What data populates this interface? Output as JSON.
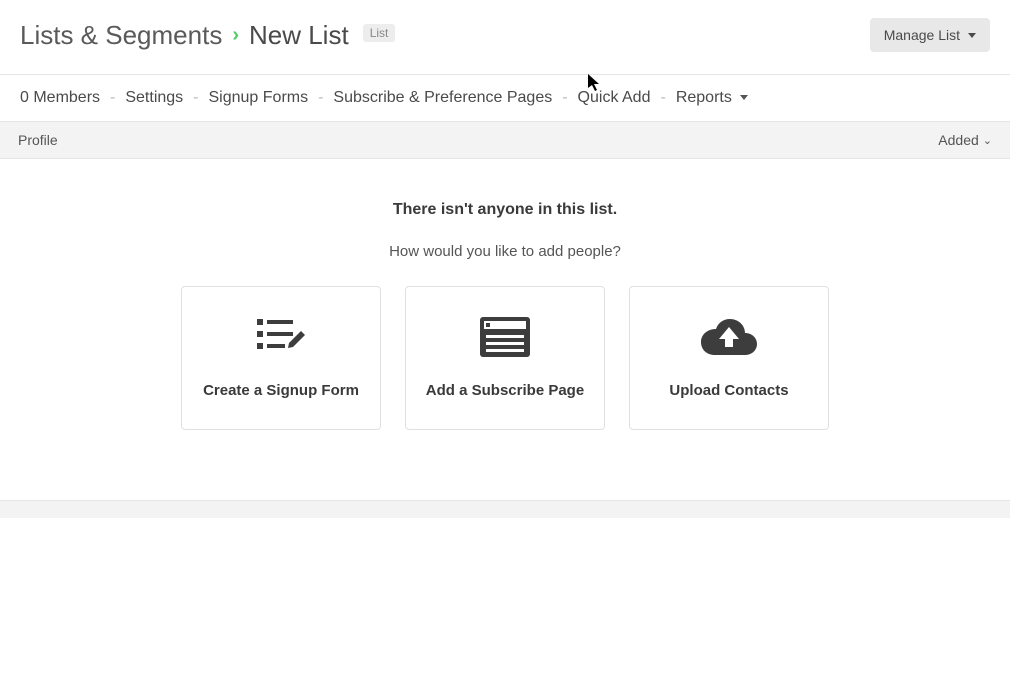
{
  "header": {
    "breadcrumb_root": "Lists & Segments",
    "current": "New List",
    "badge": "List",
    "manage_button": "Manage List"
  },
  "subnav": {
    "items": [
      "0 Members",
      "Settings",
      "Signup Forms",
      "Subscribe & Preference Pages",
      "Quick Add",
      "Reports"
    ]
  },
  "table_header": {
    "col_profile": "Profile",
    "col_added": "Added"
  },
  "empty_state": {
    "title": "There isn't anyone in this list.",
    "subtitle": "How would you like to add people?",
    "cards": [
      {
        "label": "Create a Signup Form"
      },
      {
        "label": "Add a Subscribe Page"
      },
      {
        "label": "Upload Contacts"
      }
    ]
  }
}
